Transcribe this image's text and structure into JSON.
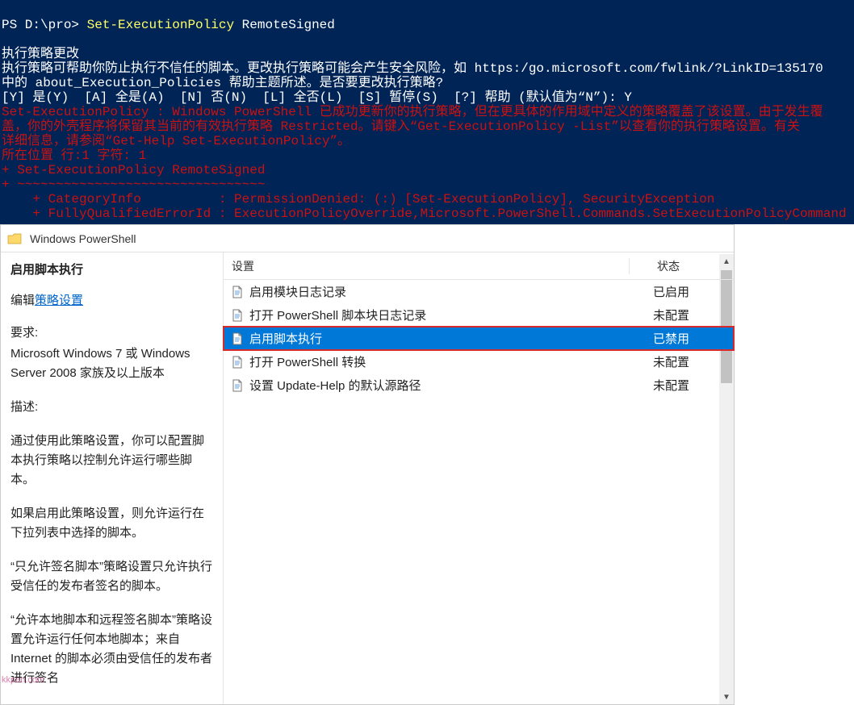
{
  "terminal": {
    "prompt": "PS D:\\pro> ",
    "command_part1": "Set-ExecutionPolicy",
    "command_part2": " RemoteSigned",
    "heading": "执行策略更改",
    "body_line1": "执行策略可帮助你防止执行不信任的脚本。更改执行策略可能会产生安全风险，如 https:/go.microsoft.com/fwlink/?LinkID=135170",
    "body_line2": "中的 about_Execution_Policies 帮助主题所述。是否要更改执行策略?",
    "choices": "[Y] 是(Y)  [A] 全是(A)  [N] 否(N)  [L] 全否(L)  [S] 暂停(S)  [?] 帮助 (默认值为“N”): Y",
    "err1": "Set-ExecutionPolicy : Windows PowerShell 已成功更新你的执行策略，但在更具体的作用域中定义的策略覆盖了该设置。由于发生覆",
    "err2": "盖，你的外壳程序将保留其当前的有效执行策略 Restricted。请键入“Get-ExecutionPolicy -List”以查看你的执行策略设置。有关",
    "err3": "详细信息，请参阅“Get-Help Set-ExecutionPolicy”。",
    "err_loc": "所在位置 行:1 字符: 1",
    "err_cmd": "+ Set-ExecutionPolicy RemoteSigned",
    "err_tilde": "+ ~~~~~~~~~~~~~~~~~~~~~~~~~~~~~~~~",
    "err_cat": "    + CategoryInfo          : PermissionDenied: (:) [Set-ExecutionPolicy], SecurityException",
    "err_fq": "    + FullyQualifiedErrorId : ExecutionPolicyOverride,Microsoft.PowerShell.Commands.SetExecutionPolicyCommand"
  },
  "gp": {
    "window_title": "Windows PowerShell",
    "left": {
      "policy_name": "启用脚本执行",
      "edit_prefix": "编辑",
      "edit_link": "策略设置",
      "req_label": "要求:",
      "req_text": "Microsoft Windows 7 或 Windows Server 2008 家族及以上版本",
      "desc_label": "描述:",
      "desc_p1": "通过使用此策略设置，你可以配置脚本执行策略以控制允许运行哪些脚本。",
      "desc_p2": "如果启用此策略设置，则允许运行在下拉列表中选择的脚本。",
      "desc_p3": "“只允许签名脚本”策略设置只允许执行受信任的发布者签名的脚本。",
      "desc_p4": "“允许本地脚本和远程签名脚本”策略设置允许运行任何本地脚本；来自 Internet 的脚本必须由受信任的发布者进行签名"
    },
    "headers": {
      "setting": "设置",
      "state": "状态"
    },
    "rows": [
      {
        "label": "启用模块日志记录",
        "state": "已启用",
        "selected": false
      },
      {
        "label": "打开 PowerShell 脚本块日志记录",
        "state": "未配置",
        "selected": false
      },
      {
        "label": "启用脚本执行",
        "state": "已禁用",
        "selected": true
      },
      {
        "label": "打开 PowerShell 转换",
        "state": "未配置",
        "selected": false
      },
      {
        "label": "设置 Update-Help 的默认源路径",
        "state": "未配置",
        "selected": false
      }
    ]
  },
  "watermark": "kkpan.com"
}
